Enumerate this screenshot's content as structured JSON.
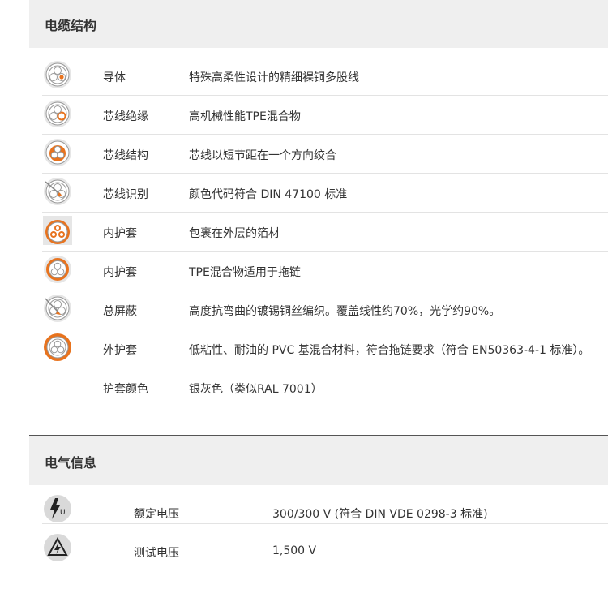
{
  "sections": {
    "structure_title": "电缆结构",
    "electrical_title": "电气信息"
  },
  "structure_rows": [
    {
      "icon": "conductor-icon",
      "label": "导体",
      "value": "特殊高柔性设计的精细裸铜多股线"
    },
    {
      "icon": "core-insulation-icon",
      "label": "芯线绝缘",
      "value": "高机械性能TPE混合物"
    },
    {
      "icon": "core-structure-icon",
      "label": "芯线结构",
      "value": "芯线以短节距在一个方向绞合"
    },
    {
      "icon": "core-identification-icon",
      "label": "芯线识别",
      "value": "颜色代码符合 DIN 47100 标准"
    },
    {
      "icon": "inner-sheath-filler-icon",
      "label": "内护套",
      "value": "包裹在外层的箔材"
    },
    {
      "icon": "inner-sheath-icon",
      "label": "内护套",
      "value": "TPE混合物适用于拖链"
    },
    {
      "icon": "overall-shield-icon",
      "label": "总屏蔽",
      "value": "高度抗弯曲的镀锡铜丝编织。覆盖线性约70%，光学约90%。"
    },
    {
      "icon": "outer-sheath-icon",
      "label": "外护套",
      "value": "低粘性、耐油的 PVC 基混合材料，符合拖链要求（符合 EN50363-4-1 标准）。"
    },
    {
      "icon": "",
      "label": "护套颜色",
      "value": "银灰色（类似RAL 7001）"
    }
  ],
  "electrical_rows": [
    {
      "icon": "rated-voltage-icon",
      "label": "额定电压",
      "value": "300/300 V (符合 DIN VDE 0298-3 标准)"
    },
    {
      "icon": "test-voltage-icon",
      "label": "测试电压",
      "value": "1,500 V"
    }
  ],
  "colors": {
    "accent": "#e8731e",
    "band": "#efefef",
    "text": "#333333"
  }
}
